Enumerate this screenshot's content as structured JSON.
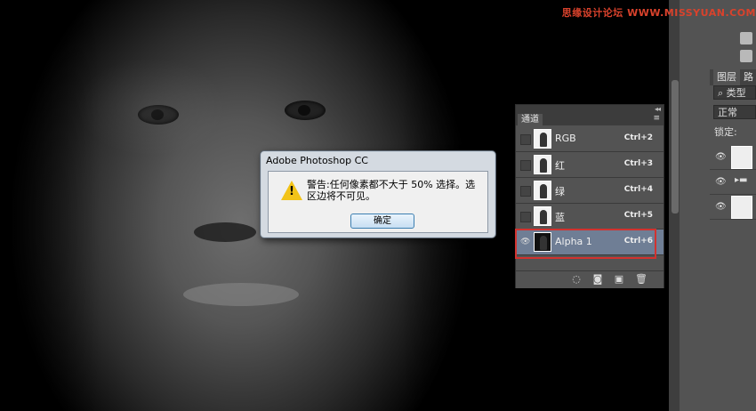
{
  "watermark": {
    "site": "思缘设计论坛",
    "url": "WWW.MISSYUAN.COM"
  },
  "dialog": {
    "title": "Adobe Photoshop CC",
    "message": "警告:任何像素都不大于 50% 选择。选区边将不可见。",
    "ok_label": "确定"
  },
  "channels_panel": {
    "tab_label": "通道",
    "menu_icon": "menu-icon",
    "collapse_icon": "double-chevron-icon",
    "rows": [
      {
        "name": "RGB",
        "shortcut": "Ctrl+2"
      },
      {
        "name": "红",
        "shortcut": "Ctrl+3"
      },
      {
        "name": "绿",
        "shortcut": "Ctrl+4"
      },
      {
        "name": "蓝",
        "shortcut": "Ctrl+5"
      },
      {
        "name": "Alpha 1",
        "shortcut": "Ctrl+6",
        "active": true
      }
    ],
    "footer_icons": [
      "load-selection-icon",
      "save-selection-icon",
      "new-channel-icon",
      "delete-icon"
    ]
  },
  "layers_panel": {
    "tab_label": "图层",
    "tab2_label": "路径",
    "filter_label": "类型",
    "blend_mode": "正常",
    "lock_label": "锁定:"
  },
  "colors": {
    "highlight": "#d2322f",
    "selected_row": "#6f7e95",
    "warning": "#f2c318"
  }
}
